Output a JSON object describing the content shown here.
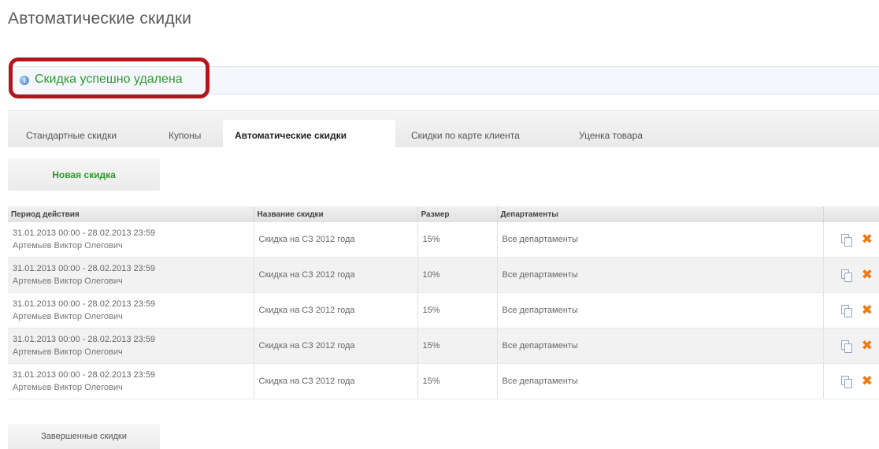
{
  "page": {
    "title": "Автоматические скидки"
  },
  "notice": {
    "icon": "info-icon",
    "text": "Скидка успешно удалена"
  },
  "tabs": [
    {
      "label": "Стандартные скидки",
      "active": false
    },
    {
      "label": "Купоны",
      "active": false
    },
    {
      "label": "Автоматические скидки",
      "active": true
    },
    {
      "label": "Скидки по карте клиента",
      "active": false
    },
    {
      "label": "Уценка товара",
      "active": false
    }
  ],
  "actions": {
    "new_discount": "Новая скидка",
    "finished_discounts": "Завершенные скидки"
  },
  "table": {
    "headers": [
      "Период действия",
      "Название скидки",
      "Размер",
      "Департаменты"
    ],
    "rows": [
      {
        "period": "31.01.2013 00:00 - 28.02.2013 23:59",
        "author": "Артемьев Виктор Олегович",
        "name": "Скидка на СЗ 2012 года",
        "size": "15%",
        "departments": "Все департаменты"
      },
      {
        "period": "31.01.2013 00:00 - 28.02.2013 23:59",
        "author": "Артемьев Виктор Олегович",
        "name": "Скидка на СЗ 2012 года",
        "size": "10%",
        "departments": "Все департаменты"
      },
      {
        "period": "31.01.2013 00:00 - 28.02.2013 23:59",
        "author": "Артемьев Виктор Олегович",
        "name": "Скидка на СЗ 2012 года",
        "size": "15%",
        "departments": "Все департаменты"
      },
      {
        "period": "31.01.2013 00:00 - 28.02.2013 23:59",
        "author": "Артемьев Виктор Олегович",
        "name": "Скидка на СЗ 2012 года",
        "size": "15%",
        "departments": "Все департаменты"
      },
      {
        "period": "31.01.2013 00:00 - 28.02.2013 23:59",
        "author": "Артемьев Виктор Олегович",
        "name": "Скидка на СЗ 2012 года",
        "size": "15%",
        "departments": "Все департаменты"
      }
    ],
    "row_icons": {
      "copy": "copy-icon",
      "delete": "delete-icon"
    }
  },
  "colors": {
    "highlight": "#b5141c",
    "success": "#2f9a2f",
    "delete": "#ee7a14"
  }
}
